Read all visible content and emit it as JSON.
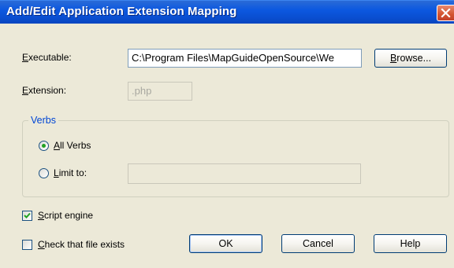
{
  "dialog": {
    "title": "Add/Edit Application Extension Mapping",
    "executable_label": "Executable:",
    "executable_value": "C:\\Program Files\\MapGuideOpenSource\\We",
    "browse_label": "Browse...",
    "extension_label": "Extension:",
    "extension_value": ".php",
    "verbs_group": "Verbs",
    "all_verbs_label": "All Verbs",
    "all_verbs_selected": true,
    "limit_to_label": "Limit to:",
    "limit_to_value": "",
    "script_engine_label": "Script engine",
    "script_engine_checked": true,
    "check_file_label": "Check that file exists",
    "check_file_checked": false,
    "ok_label": "OK",
    "cancel_label": "Cancel",
    "help_label": "Help"
  },
  "icons": {
    "close": "close-icon",
    "check": "checkmark-icon"
  },
  "colors": {
    "title_bar": "#0a4fd2",
    "close_button": "#d3532f",
    "dialog_bg": "#ece9d8",
    "group_title": "#0046d5",
    "check_green": "#21a121"
  }
}
